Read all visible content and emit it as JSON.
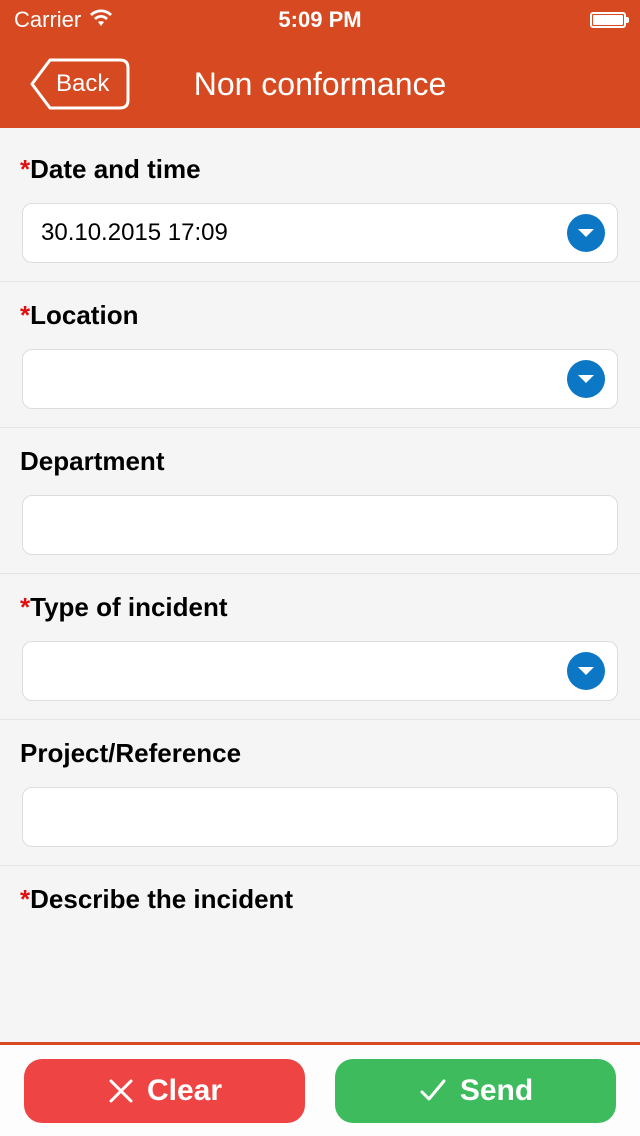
{
  "status": {
    "carrier": "Carrier",
    "time": "5:09 PM"
  },
  "nav": {
    "back": "Back",
    "title": "Non conformance"
  },
  "fields": {
    "datetime": {
      "label": "Date and time",
      "value": "30.10.2015 17:09",
      "required": true,
      "dropdown": true
    },
    "location": {
      "label": "Location",
      "value": "",
      "required": true,
      "dropdown": true
    },
    "department": {
      "label": "Department",
      "value": "",
      "required": false,
      "dropdown": false
    },
    "incident_type": {
      "label": "Type of incident",
      "value": "",
      "required": true,
      "dropdown": true
    },
    "project": {
      "label": "Project/Reference",
      "value": "",
      "required": false,
      "dropdown": false
    },
    "describe": {
      "label": "Describe the incident",
      "value": "",
      "required": true,
      "dropdown": false
    }
  },
  "actions": {
    "clear": "Clear",
    "send": "Send"
  },
  "colors": {
    "brand": "#d74a21",
    "dropdown": "#0b77c5",
    "clear": "#ef4444",
    "send": "#3ebb5d",
    "required": "#e01010"
  }
}
